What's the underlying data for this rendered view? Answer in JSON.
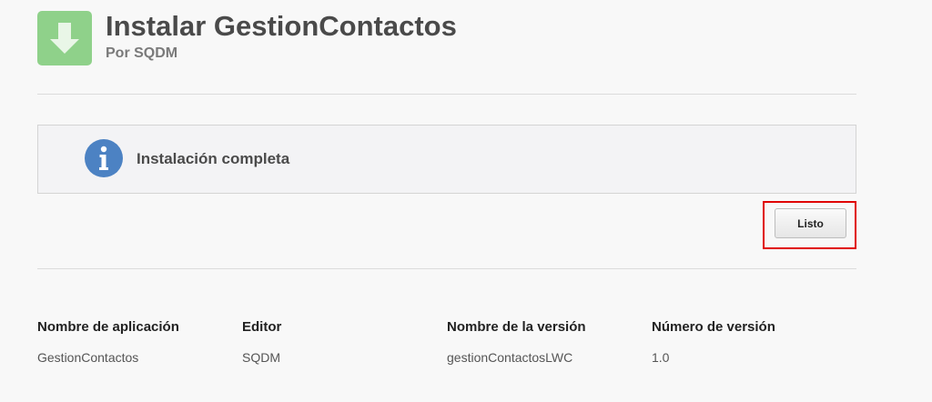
{
  "header": {
    "title": "Instalar GestionContactos",
    "subtitle": "Por SQDM",
    "icon": "download-icon"
  },
  "message": {
    "icon": "info-icon",
    "text": "Instalación completa"
  },
  "actions": {
    "done_label": "Listo"
  },
  "details": {
    "columns": [
      {
        "label": "Nombre de aplicación",
        "value": "GestionContactos"
      },
      {
        "label": "Editor",
        "value": "SQDM"
      },
      {
        "label": "Nombre de la versión",
        "value": "gestionContactosLWC"
      },
      {
        "label": "Número de versión",
        "value": "1.0"
      }
    ]
  },
  "colors": {
    "icon_green": "#8fd18a",
    "info_blue": "#4c82c3",
    "highlight_red": "#e00000"
  }
}
